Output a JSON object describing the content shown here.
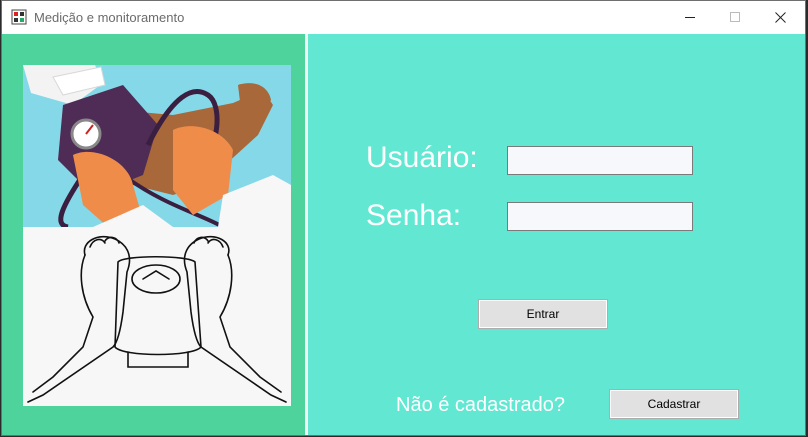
{
  "window": {
    "title": "Medição e monitoramento",
    "controls": [
      "minimize-icon",
      "maximize-icon",
      "close-icon"
    ]
  },
  "login": {
    "user_label": "Usuário:",
    "password_label": "Senha:",
    "user_value": "",
    "password_value": "",
    "login_button": "Entrar",
    "register_question": "Não é cadastrado?",
    "register_button": "Cadastrar"
  },
  "colors": {
    "left_panel": "#4fd39c",
    "right_panel": "#62e8d2",
    "illustration_sky": "#85d8e8",
    "cuff": "#4e2c55",
    "skin": "#a8683a",
    "glove": "#f08c4a"
  }
}
